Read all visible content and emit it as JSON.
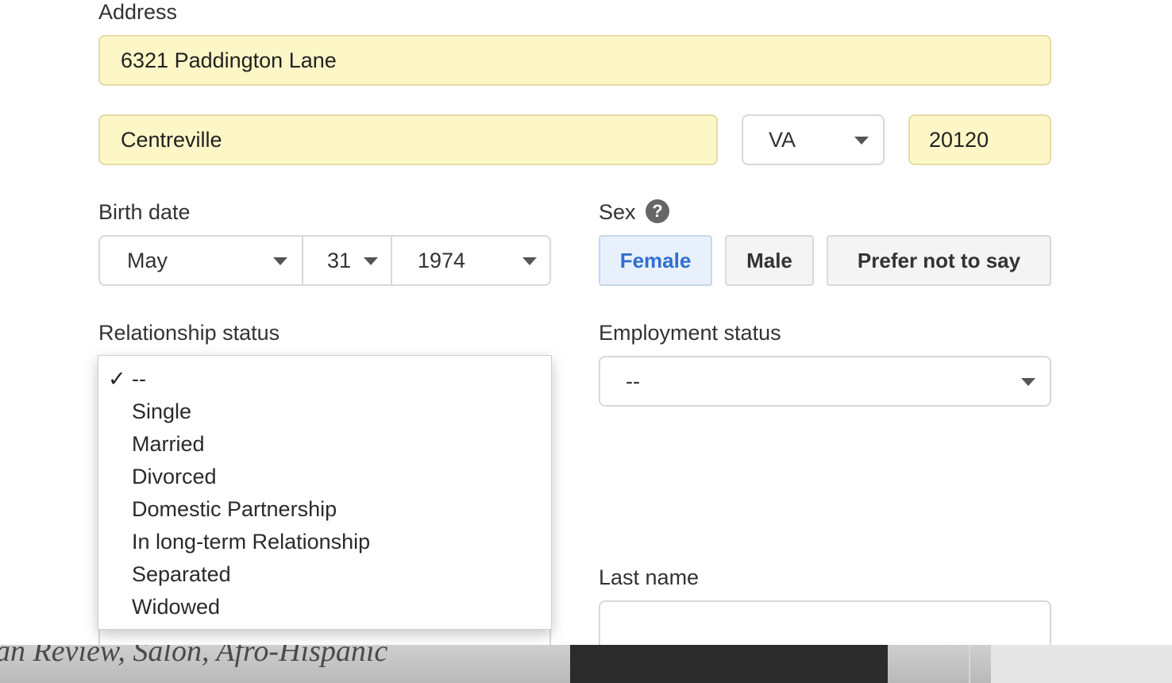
{
  "address": {
    "label": "Address",
    "street": "6321 Paddington Lane",
    "city": "Centreville",
    "state": "VA",
    "zip": "20120"
  },
  "birth": {
    "label": "Birth date",
    "month": "May",
    "day": "31",
    "year": "1974"
  },
  "sex": {
    "label": "Sex",
    "help_glyph": "?",
    "options": [
      "Female",
      "Male",
      "Prefer not to say"
    ],
    "selected": "Female"
  },
  "relationship": {
    "label": "Relationship status",
    "check_glyph": "✓",
    "options": [
      "--",
      "Single",
      "Married",
      "Divorced",
      "Domestic Partnership",
      "In long-term Relationship",
      "Separated",
      "Widowed"
    ],
    "selected": "--"
  },
  "employment": {
    "label": "Employment status",
    "value": "--"
  },
  "last_name": {
    "label": "Last name",
    "value": ""
  },
  "background_page": {
    "text": "an Review, Salon, Afro-Hispanic"
  },
  "colors": {
    "autofill_bg": "#fdf7c7",
    "active_accent": "#2f6fd0"
  }
}
